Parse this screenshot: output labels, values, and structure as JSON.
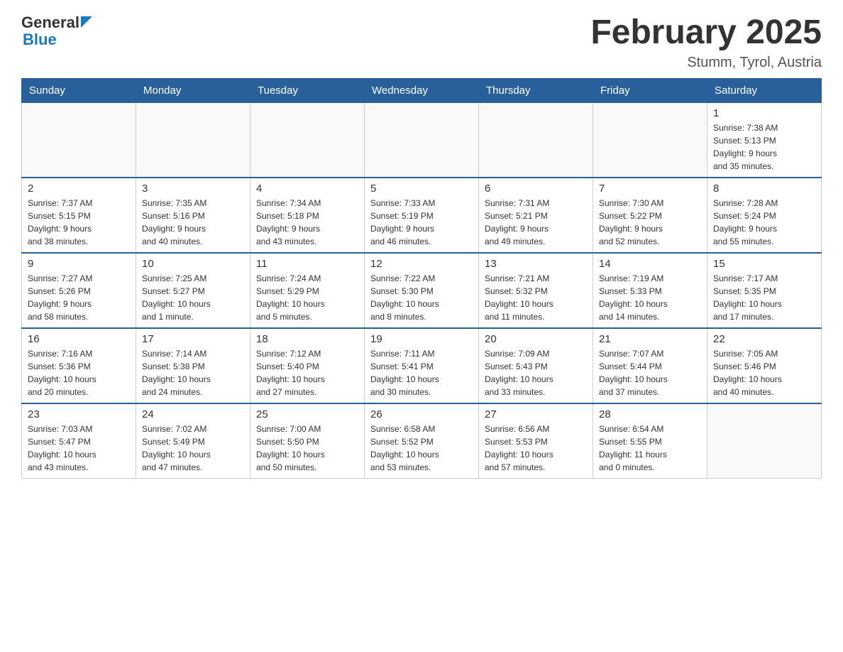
{
  "header": {
    "logo_general": "General",
    "logo_blue": "Blue",
    "month_title": "February 2025",
    "location": "Stumm, Tyrol, Austria"
  },
  "days_of_week": [
    "Sunday",
    "Monday",
    "Tuesday",
    "Wednesday",
    "Thursday",
    "Friday",
    "Saturday"
  ],
  "weeks": [
    [
      {
        "day": "",
        "info": ""
      },
      {
        "day": "",
        "info": ""
      },
      {
        "day": "",
        "info": ""
      },
      {
        "day": "",
        "info": ""
      },
      {
        "day": "",
        "info": ""
      },
      {
        "day": "",
        "info": ""
      },
      {
        "day": "1",
        "info": "Sunrise: 7:38 AM\nSunset: 5:13 PM\nDaylight: 9 hours\nand 35 minutes."
      }
    ],
    [
      {
        "day": "2",
        "info": "Sunrise: 7:37 AM\nSunset: 5:15 PM\nDaylight: 9 hours\nand 38 minutes."
      },
      {
        "day": "3",
        "info": "Sunrise: 7:35 AM\nSunset: 5:16 PM\nDaylight: 9 hours\nand 40 minutes."
      },
      {
        "day": "4",
        "info": "Sunrise: 7:34 AM\nSunset: 5:18 PM\nDaylight: 9 hours\nand 43 minutes."
      },
      {
        "day": "5",
        "info": "Sunrise: 7:33 AM\nSunset: 5:19 PM\nDaylight: 9 hours\nand 46 minutes."
      },
      {
        "day": "6",
        "info": "Sunrise: 7:31 AM\nSunset: 5:21 PM\nDaylight: 9 hours\nand 49 minutes."
      },
      {
        "day": "7",
        "info": "Sunrise: 7:30 AM\nSunset: 5:22 PM\nDaylight: 9 hours\nand 52 minutes."
      },
      {
        "day": "8",
        "info": "Sunrise: 7:28 AM\nSunset: 5:24 PM\nDaylight: 9 hours\nand 55 minutes."
      }
    ],
    [
      {
        "day": "9",
        "info": "Sunrise: 7:27 AM\nSunset: 5:26 PM\nDaylight: 9 hours\nand 58 minutes."
      },
      {
        "day": "10",
        "info": "Sunrise: 7:25 AM\nSunset: 5:27 PM\nDaylight: 10 hours\nand 1 minute."
      },
      {
        "day": "11",
        "info": "Sunrise: 7:24 AM\nSunset: 5:29 PM\nDaylight: 10 hours\nand 5 minutes."
      },
      {
        "day": "12",
        "info": "Sunrise: 7:22 AM\nSunset: 5:30 PM\nDaylight: 10 hours\nand 8 minutes."
      },
      {
        "day": "13",
        "info": "Sunrise: 7:21 AM\nSunset: 5:32 PM\nDaylight: 10 hours\nand 11 minutes."
      },
      {
        "day": "14",
        "info": "Sunrise: 7:19 AM\nSunset: 5:33 PM\nDaylight: 10 hours\nand 14 minutes."
      },
      {
        "day": "15",
        "info": "Sunrise: 7:17 AM\nSunset: 5:35 PM\nDaylight: 10 hours\nand 17 minutes."
      }
    ],
    [
      {
        "day": "16",
        "info": "Sunrise: 7:16 AM\nSunset: 5:36 PM\nDaylight: 10 hours\nand 20 minutes."
      },
      {
        "day": "17",
        "info": "Sunrise: 7:14 AM\nSunset: 5:38 PM\nDaylight: 10 hours\nand 24 minutes."
      },
      {
        "day": "18",
        "info": "Sunrise: 7:12 AM\nSunset: 5:40 PM\nDaylight: 10 hours\nand 27 minutes."
      },
      {
        "day": "19",
        "info": "Sunrise: 7:11 AM\nSunset: 5:41 PM\nDaylight: 10 hours\nand 30 minutes."
      },
      {
        "day": "20",
        "info": "Sunrise: 7:09 AM\nSunset: 5:43 PM\nDaylight: 10 hours\nand 33 minutes."
      },
      {
        "day": "21",
        "info": "Sunrise: 7:07 AM\nSunset: 5:44 PM\nDaylight: 10 hours\nand 37 minutes."
      },
      {
        "day": "22",
        "info": "Sunrise: 7:05 AM\nSunset: 5:46 PM\nDaylight: 10 hours\nand 40 minutes."
      }
    ],
    [
      {
        "day": "23",
        "info": "Sunrise: 7:03 AM\nSunset: 5:47 PM\nDaylight: 10 hours\nand 43 minutes."
      },
      {
        "day": "24",
        "info": "Sunrise: 7:02 AM\nSunset: 5:49 PM\nDaylight: 10 hours\nand 47 minutes."
      },
      {
        "day": "25",
        "info": "Sunrise: 7:00 AM\nSunset: 5:50 PM\nDaylight: 10 hours\nand 50 minutes."
      },
      {
        "day": "26",
        "info": "Sunrise: 6:58 AM\nSunset: 5:52 PM\nDaylight: 10 hours\nand 53 minutes."
      },
      {
        "day": "27",
        "info": "Sunrise: 6:56 AM\nSunset: 5:53 PM\nDaylight: 10 hours\nand 57 minutes."
      },
      {
        "day": "28",
        "info": "Sunrise: 6:54 AM\nSunset: 5:55 PM\nDaylight: 11 hours\nand 0 minutes."
      },
      {
        "day": "",
        "info": ""
      }
    ]
  ]
}
